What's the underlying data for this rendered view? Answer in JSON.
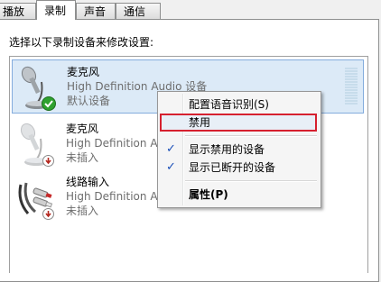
{
  "tabs": [
    {
      "label": "播放"
    },
    {
      "label": "录制"
    },
    {
      "label": "声音"
    },
    {
      "label": "通信"
    }
  ],
  "instruction": "选择以下录制设备来修改设置:",
  "devices": [
    {
      "name": "麦克风",
      "description": "High Definition Audio 设备",
      "status": "默认设备",
      "icon": "microphone-icon",
      "badge": "check-badge-icon"
    },
    {
      "name": "麦克风",
      "description": "High Definition Audio 设备",
      "status": "未插入",
      "icon": "microphone-icon",
      "badge": "unplugged-badge-icon"
    },
    {
      "name": "线路输入",
      "description": "High Definition Audio 设备",
      "status": "未插入",
      "icon": "line-in-cable-icon",
      "badge": "unplugged-badge-icon"
    }
  ],
  "context_menu": {
    "items": [
      {
        "label": "配置语音识别(S)",
        "checked": false
      },
      {
        "label": "禁用",
        "checked": false,
        "highlighted": true
      },
      {
        "label": "显示禁用的设备",
        "checked": true
      },
      {
        "label": "显示已断开的设备",
        "checked": true
      },
      {
        "label": "属性(P)",
        "checked": false,
        "bold": true
      }
    ]
  },
  "colors": {
    "selection": "#dceaf7",
    "highlight_border": "#d6202f",
    "check": "#1a4fb8"
  }
}
